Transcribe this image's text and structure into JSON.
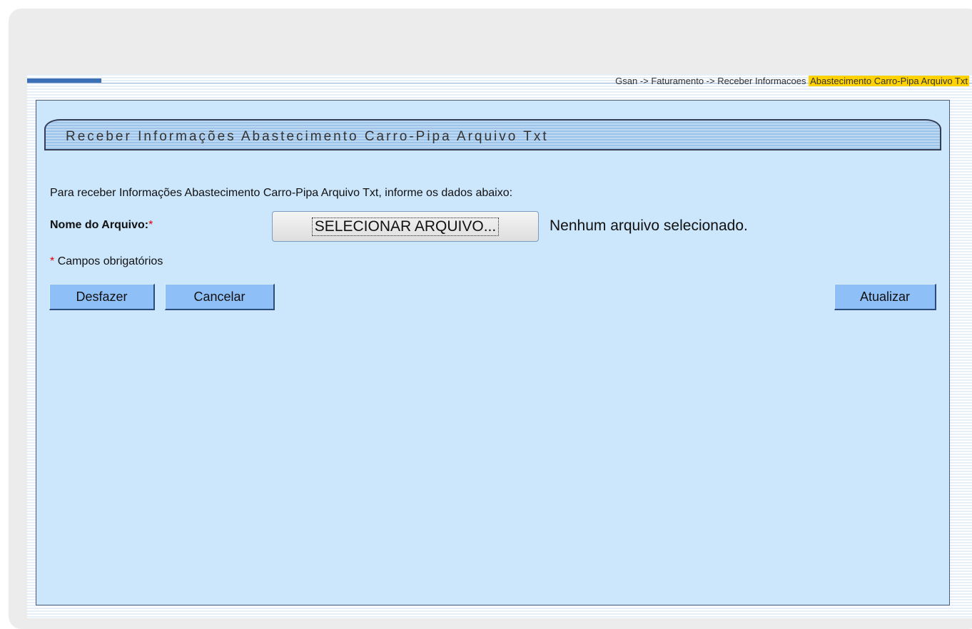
{
  "breadcrumb": {
    "path": "Gsan -> Faturamento -> Receber Informacoes",
    "current": "Abastecimento Carro-Pipa Arquivo Txt"
  },
  "form": {
    "title": "Receber Informações Abastecimento Carro-Pipa Arquivo Txt",
    "intro": "Para receber Informações Abastecimento Carro-Pipa Arquivo Txt, informe os dados abaixo:",
    "file_label": "Nome do Arquivo:",
    "required_marker": "*",
    "file_button_label": "SELECIONAR ARQUIVO...",
    "file_status": "Nenhum arquivo selecionado.",
    "required_note": "Campos obrigatórios"
  },
  "buttons": {
    "undo": "Desfazer",
    "cancel": "Cancelar",
    "update": "Atualizar"
  },
  "colors": {
    "panel_bg": "#cce6fc",
    "button_bg": "#8ec0f7",
    "highlight": "#ffd200",
    "required": "#e00000"
  }
}
